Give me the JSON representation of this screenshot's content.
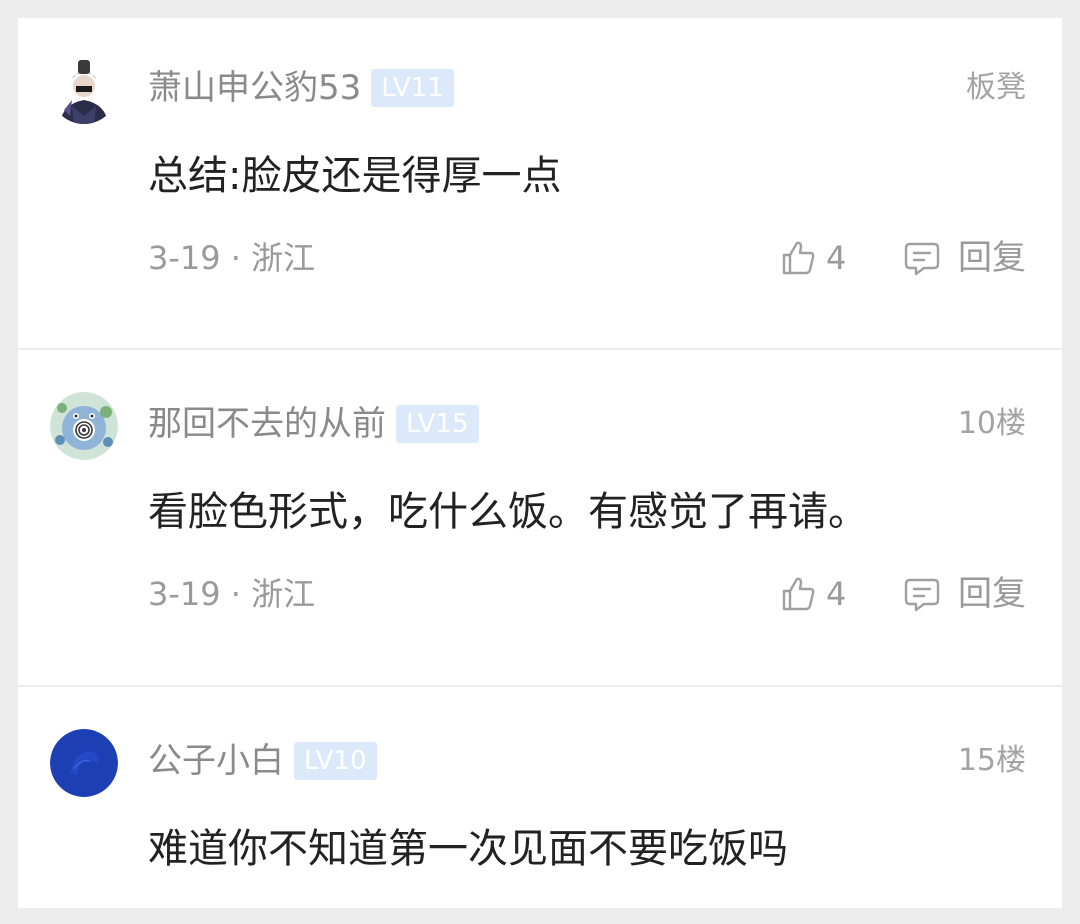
{
  "comments": [
    {
      "username": "萧山申公豹53",
      "level": "LV11",
      "floor": "板凳",
      "text": "总结:脸皮还是得厚一点",
      "meta": "3-19 · 浙江",
      "likes": "4",
      "reply_label": "回复",
      "avatar_icon": "anime-character-avatar"
    },
    {
      "username": "那回不去的从前",
      "level": "LV15",
      "floor": "10楼",
      "text": "看脸色形式，吃什么饭。有感觉了再请。",
      "meta": "3-19 · 浙江",
      "likes": "4",
      "reply_label": "回复",
      "avatar_icon": "pokemon-avatar"
    },
    {
      "username": "公子小白",
      "level": "LV10",
      "floor": "15楼",
      "text": "难道你不知道第一次见面不要吃饭吗",
      "avatar_icon": "blue-circle-avatar"
    }
  ],
  "colors": {
    "level_badge_bg": "#dce9fb",
    "meta_text": "#9a9a9a",
    "body_text": "#222222"
  }
}
